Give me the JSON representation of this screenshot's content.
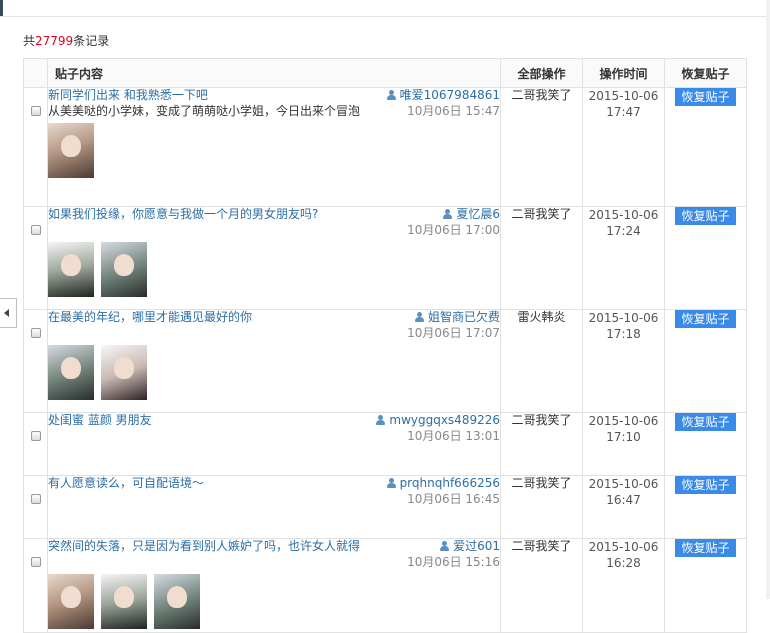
{
  "summary": {
    "prefix": "共",
    "count": "27799",
    "suffix": "条记录"
  },
  "table": {
    "headers": {
      "content": "贴子内容",
      "operator": "全部操作",
      "time": "操作时间",
      "action": "恢复贴子"
    },
    "rows": [
      {
        "title": "新同学们出来 和我熟悉一下吧",
        "body": "从美美哒的小学妹，变成了萌萌哒小学姐，今日出来个冒泡",
        "author": "唯爱1067984861",
        "date": "10月06日 15:47",
        "operator": "二哥我笑了",
        "time_date": "2015-10-06",
        "time_clock": "17:47",
        "action": "恢复贴子",
        "thumbs": 1
      },
      {
        "title": "如果我们投缘，你愿意与我做一个月的男女朋友吗?",
        "body": "",
        "author": "夏忆晨6",
        "date": "10月06日 17:00",
        "operator": "二哥我笑了",
        "time_date": "2015-10-06",
        "time_clock": "17:24",
        "action": "恢复贴子",
        "thumbs": 2
      },
      {
        "title": "在最美的年纪，哪里才能遇见最好的你",
        "body": "",
        "author": "姐智商已欠费",
        "date": "10月06日 17:07",
        "operator": "雷火韩炎",
        "time_date": "2015-10-06",
        "time_clock": "17:18",
        "action": "恢复贴子",
        "thumbs": 2
      },
      {
        "title": "处闺蜜 蓝颜 男朋友",
        "body": "",
        "author": "mwyggqxs489226",
        "date": "10月06日 13:01",
        "operator": "二哥我笑了",
        "time_date": "2015-10-06",
        "time_clock": "17:10",
        "action": "恢复贴子",
        "thumbs": 0
      },
      {
        "title": "有人愿意读么，可自配语境～",
        "body": "",
        "author": "prqhnqhf666256",
        "date": "10月06日 16:45",
        "operator": "二哥我笑了",
        "time_date": "2015-10-06",
        "time_clock": "16:47",
        "action": "恢复贴子",
        "thumbs": 0
      },
      {
        "title": "突然间的失落，只是因为看到别人嫉妒了吗，也许女人就得",
        "body": "",
        "author": "爱过601",
        "date": "10月06日 15:16",
        "operator": "二哥我笑了",
        "time_date": "2015-10-06",
        "time_clock": "16:28",
        "action": "恢复贴子",
        "thumbs": 3
      }
    ]
  },
  "colors": {
    "link": "#2b6ea5",
    "count": "#e0001b",
    "button": "#3a8ae8"
  }
}
